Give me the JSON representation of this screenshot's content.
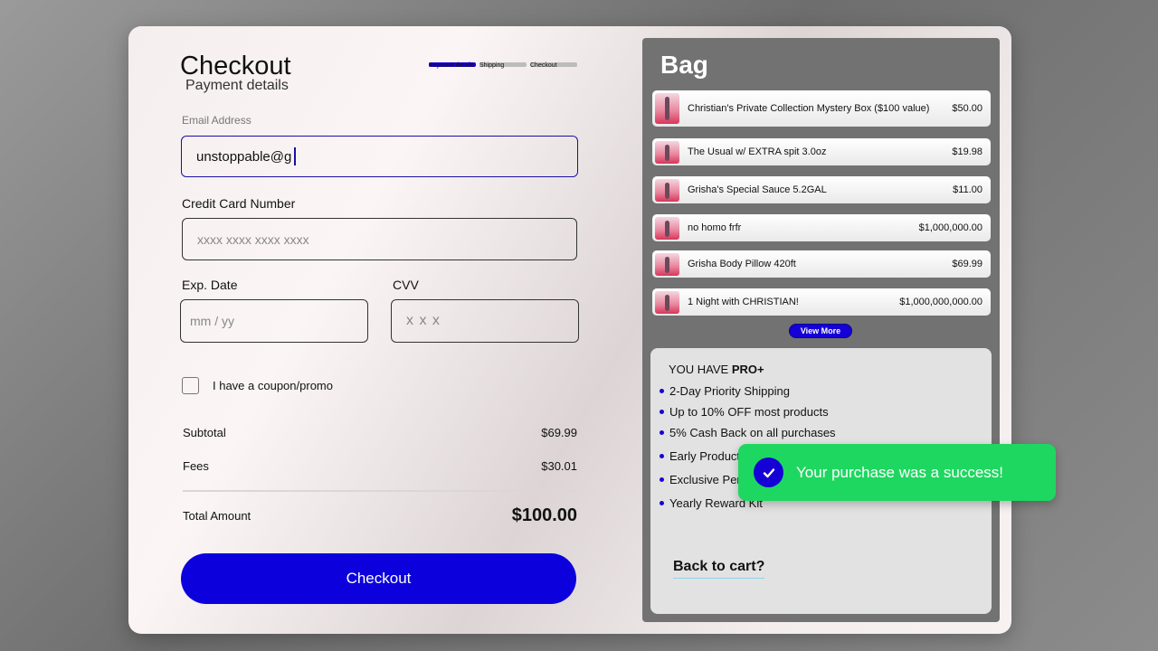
{
  "checkout": {
    "title": "Checkout",
    "subtitle": "Payment details",
    "steps": [
      {
        "label": "Payment details",
        "active": true
      },
      {
        "label": "Shipping",
        "active": false
      },
      {
        "label": "Checkout",
        "active": false
      }
    ],
    "email_label": "Email Address",
    "email_value": "unstoppable@g",
    "cc_label": "Credit Card Number",
    "cc_placeholder": "xxxx xxxx xxxx xxxx",
    "exp_label": "Exp. Date",
    "exp_placeholder": "mm / yy",
    "cvv_label": "CVV",
    "cvv_placeholder": "x x x",
    "coupon_label": "I have a coupon/promo",
    "subtotal_label": "Subtotal",
    "subtotal_value": "$69.99",
    "fees_label": "Fees",
    "fees_value": "$30.01",
    "total_label": "Total Amount",
    "total_value": "$100.00",
    "button_label": "Checkout"
  },
  "bag": {
    "title": "Bag",
    "items": [
      {
        "name": "Christian's Private Collection Mystery Box ($100 value)",
        "price": "$50.00"
      },
      {
        "name": "The Usual w/ EXTRA spit 3.0oz",
        "price": "$19.98"
      },
      {
        "name": "Grisha's Special Sauce 5.2GAL",
        "price": "$11.00"
      },
      {
        "name": "no homo frfr",
        "price": "$1,000,000.00"
      },
      {
        "name": "Grisha Body Pillow 420ft",
        "price": "$69.99"
      },
      {
        "name": "1 Night with CHRISTIAN!",
        "price": "$1,000,000,000.00"
      }
    ],
    "view_more_label": "View More"
  },
  "pro": {
    "heading_prefix": "YOU HAVE",
    "heading_bold": "PRO+",
    "perks": [
      "2-Day Priority Shipping",
      "Up to 10% OFF most products",
      "5% Cash Back on all purchases",
      "Early Product",
      "Exclusive Per",
      "Yearly Reward Kit"
    ],
    "back_link": "Back to cart?"
  },
  "toast": {
    "message": "Your purchase was a success!",
    "icon": "check-icon"
  },
  "colors": {
    "accent": "#0c00dd",
    "toast": "#1ed760",
    "bag_bg": "#727272"
  }
}
